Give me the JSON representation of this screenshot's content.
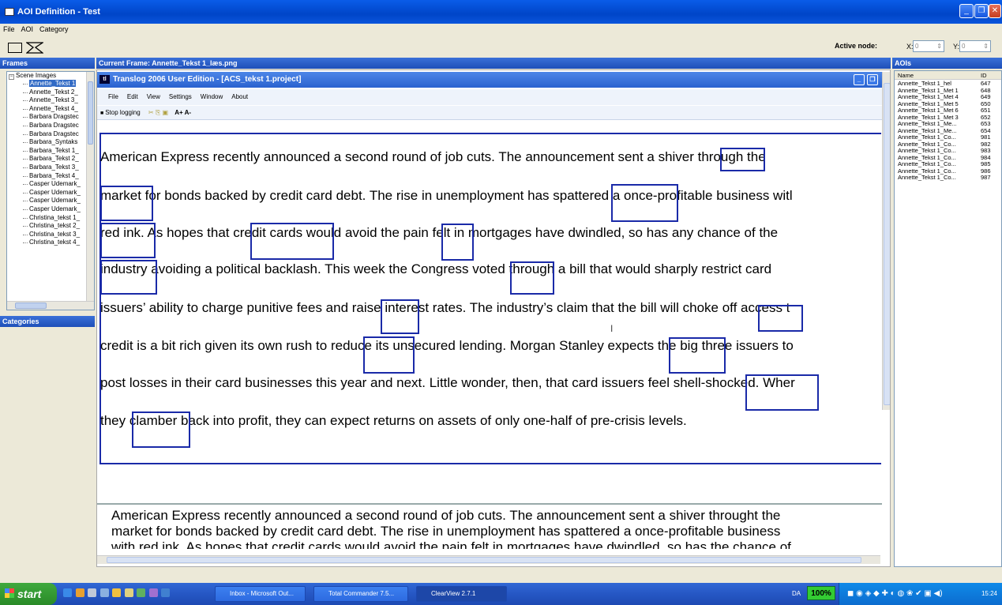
{
  "window": {
    "title": "AOI Definition - Test"
  },
  "menu": [
    "File",
    "AOI",
    "Category"
  ],
  "active_node": {
    "label": "Active node:",
    "x_label": "X:",
    "x_value": "0",
    "y_label": "Y:",
    "y_value": "0"
  },
  "frames": {
    "header": "Frames",
    "root": "Scene Images",
    "items": [
      "Annette_Tekst 1",
      "Annette_Tekst 2_",
      "Annette_Tekst 3_",
      "Annette_Tekst 4_",
      "Barbara Dragstec",
      "Barbara Dragstec",
      "Barbara Dragstec",
      "Barbara_Syntaks",
      "Barbara_Tekst 1_",
      "Barbara_Tekst 2_",
      "Barbara_Tekst 3_",
      "Barbara_Tekst 4_",
      "Casper Udemark_",
      "Casper Udemark_",
      "Casper Udemark_",
      "Casper Udemark_",
      "Christina_tekst 1_",
      "Christina_tekst 2_",
      "Christina_tekst 3_",
      "Christina_tekst 4_"
    ]
  },
  "categories": {
    "header": "Categories"
  },
  "current_frame": {
    "header": "Current Frame: Annette_Tekst 1_læs.png"
  },
  "translog": {
    "title": "Translog 2006 User Edition - [ACS_tekst 1.project]",
    "menu": [
      "File",
      "Edit",
      "View",
      "Settings",
      "Window",
      "About"
    ],
    "toolbar": {
      "stop_logging": "Stop logging",
      "font_up": "A+",
      "font_down": "A-"
    }
  },
  "document_lines": [
    "American Express recently announced a second round of job cuts. The announcement sent a shiver through the",
    "market for bonds backed by credit card debt. The rise in unemployment has spattered a once-profitable business witl",
    "red ink. As hopes that credit cards would avoid the pain felt in mortgages have dwindled, so has any chance of the",
    "industry avoiding a political backlash. This week the Congress voted through a bill that would sharply restrict card",
    "issuers’ ability to charge punitive fees and raise interest rates. The industry’s claim that the bill will choke off access t",
    "credit is a bit rich given its own rush to reduce its unsecured lending. Morgan Stanley expects the big three issuers to",
    "post losses in their card businesses this year and next. Little wonder, then, that card issuers feel shell-shocked. Wher",
    "they clamber back into profit, they can expect returns on assets of only one-half of pre-crisis levels."
  ],
  "bottom_text": [
    "American Express recently announced a second round of job cuts. The announcement sent a shiver throught the",
    "market for bonds backed by credit card debt. The rise in unemployment has spattered a once-profitable business",
    "with red ink. As hopes that credit cards would avoid the pain felt in mortgages have dwindled, so has the chance of"
  ],
  "aois": {
    "header": "AOIs",
    "columns": [
      "Name",
      "ID"
    ],
    "rows": [
      [
        "Annette_Tekst 1_hel",
        "647"
      ],
      [
        "Annette_Tekst 1_Met 1",
        "648"
      ],
      [
        "Annette_Tekst 1_Met 4",
        "649"
      ],
      [
        "Annette_Tekst 1_Met 5",
        "650"
      ],
      [
        "Annette_Tekst 1_Met 6",
        "651"
      ],
      [
        "Annette_Tekst 1_Met 3",
        "652"
      ],
      [
        "Annette_Tekst 1_Me...",
        "653"
      ],
      [
        "Annette_Tekst 1_Me...",
        "654"
      ],
      [
        "Annette_Tekst 1_Co...",
        "981"
      ],
      [
        "Annette_Tekst 1_Co...",
        "982"
      ],
      [
        "Annette_Tekst 1_Co...",
        "983"
      ],
      [
        "Annette_Tekst 1_Co...",
        "984"
      ],
      [
        "Annette_Tekst 1_Co...",
        "985"
      ],
      [
        "Annette_Tekst 1_Co...",
        "986"
      ],
      [
        "Annette_Tekst 1_Co...",
        "987"
      ]
    ]
  },
  "taskbar": {
    "start": "start",
    "tasks": [
      "Inbox - Microsoft Out...",
      "Total Commander 7.5...",
      "ClearView 2.7.1"
    ],
    "lang": "DA",
    "zoom": "100%",
    "clock": "15:24"
  },
  "colors": {
    "aoi_box": "#1a2aa8",
    "selection": "#316ac5",
    "taskbar": "#2657c4",
    "start": "#2a8a28"
  }
}
